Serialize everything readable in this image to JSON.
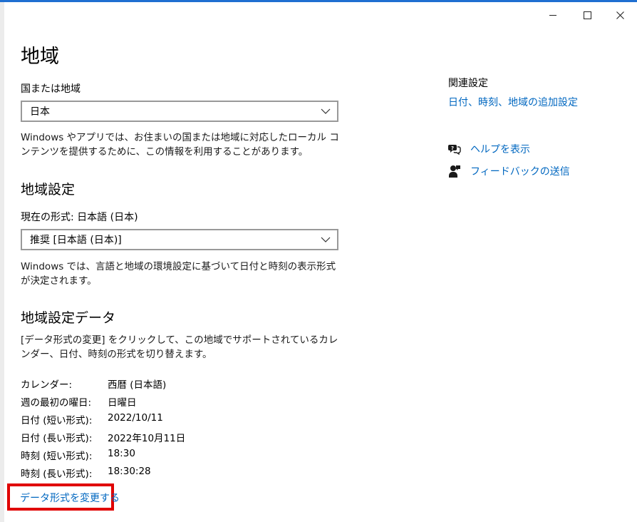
{
  "window": {
    "minimize": "minimize",
    "maximize": "maximize",
    "close": "close"
  },
  "page": {
    "title": "地域"
  },
  "country": {
    "label": "国または地域",
    "selected": "日本",
    "description": "Windows やアプリでは、お住まいの国または地域に対応したローカル コンテンツを提供するために、この情報を利用することがあります。"
  },
  "regional_format": {
    "title": "地域設定",
    "current_label": "現在の形式: 日本語 (日本)",
    "selected": "推奨 [日本語 (日本)]",
    "description": "Windows では、言語と地域の環境設定に基づいて日付と時刻の表示形式が決定されます。"
  },
  "format_data": {
    "title": "地域設定データ",
    "description": "[データ形式の変更] をクリックして、この地域でサポートされているカレンダー、日付、時刻の形式を切り替えます。",
    "rows": [
      {
        "key": "カレンダー:",
        "value": "西暦 (日本語)"
      },
      {
        "key": "週の最初の曜日:",
        "value": "日曜日"
      },
      {
        "key": "日付 (短い形式):",
        "value": "2022/10/11"
      },
      {
        "key": "日付 (長い形式):",
        "value": "2022年10月11日"
      },
      {
        "key": "時刻 (短い形式):",
        "value": "18:30"
      },
      {
        "key": "時刻 (長い形式):",
        "value": "18:30:28"
      }
    ],
    "change_link": "データ形式を変更する"
  },
  "related": {
    "title": "関連設定",
    "link": "日付、時刻、地域の追加設定",
    "help": "ヘルプを表示",
    "feedback": "フィードバックの送信"
  },
  "colors": {
    "accent": "#0067c0",
    "highlight": "#e00000",
    "border": "#999999"
  }
}
